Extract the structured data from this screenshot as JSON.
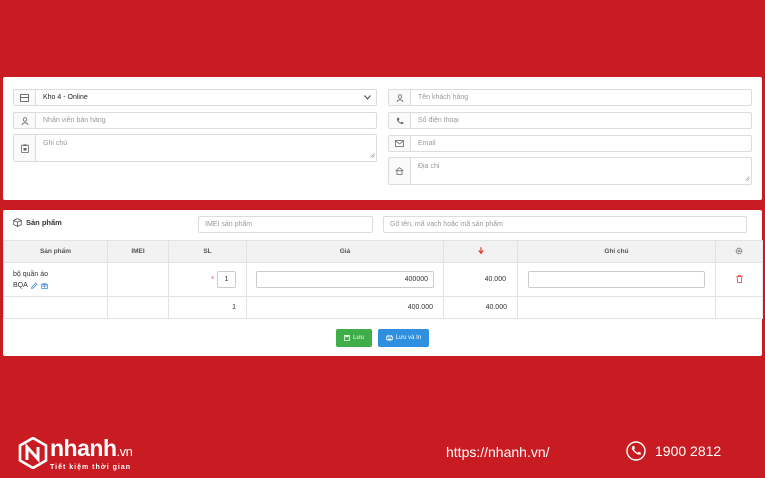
{
  "form": {
    "warehouse_value": "Kho 4 - Online",
    "salesperson_placeholder": "Nhân viên bán hàng",
    "note_placeholder": "Ghi chú",
    "customer_name_placeholder": "Tên khách hàng",
    "phone_placeholder": "Số điện thoại",
    "email_placeholder": "Email",
    "address_placeholder": "Địa chỉ"
  },
  "products": {
    "section_title": "Sản phẩm",
    "imei_placeholder": "IMEI sản phẩm",
    "search_placeholder": "Gõ tên, mã vạch hoặc mã sản phẩm",
    "columns": {
      "product": "Sản phẩm",
      "imei": "IMEI",
      "qty": "SL",
      "price": "Giá",
      "note": "Ghi chú"
    },
    "items": [
      {
        "name": "bộ quần áo",
        "code": "BQA",
        "imei": "",
        "qty": "1",
        "price": "400000",
        "amount": "40.000",
        "note": ""
      }
    ],
    "totals": {
      "qty": "1",
      "price": "400.000",
      "amount": "40.000"
    }
  },
  "actions": {
    "save_label": "Lưu",
    "save_print_label": "Lưu và In"
  },
  "footer": {
    "brand": "nhanh",
    "brand_suffix": ".vn",
    "tagline": "Tiết kiệm thời gian",
    "website": "https://nhanh.vn/",
    "hotline": "1900 2812"
  },
  "colors": {
    "background": "#c91c22",
    "save": "#3fae49",
    "save_print": "#2f8fe0",
    "sort_arrow": "#e53935",
    "delete": "#e53935"
  }
}
